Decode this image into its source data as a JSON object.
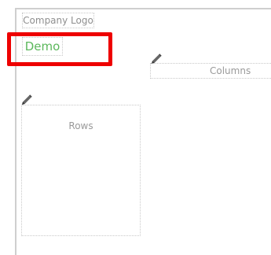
{
  "header": {
    "logo_placeholder": "Company Logo",
    "demo_label": "Demo"
  },
  "columns_area": {
    "label": "Columns",
    "edit_icon": "pencil-icon"
  },
  "rows_area": {
    "label": "Rows",
    "edit_icon": "pencil-icon"
  },
  "colors": {
    "demo_text": "#5cb85c",
    "highlight": "#ee0000",
    "placeholder_text": "#9a9a9a",
    "dotted_border": "#c9c9c9"
  }
}
